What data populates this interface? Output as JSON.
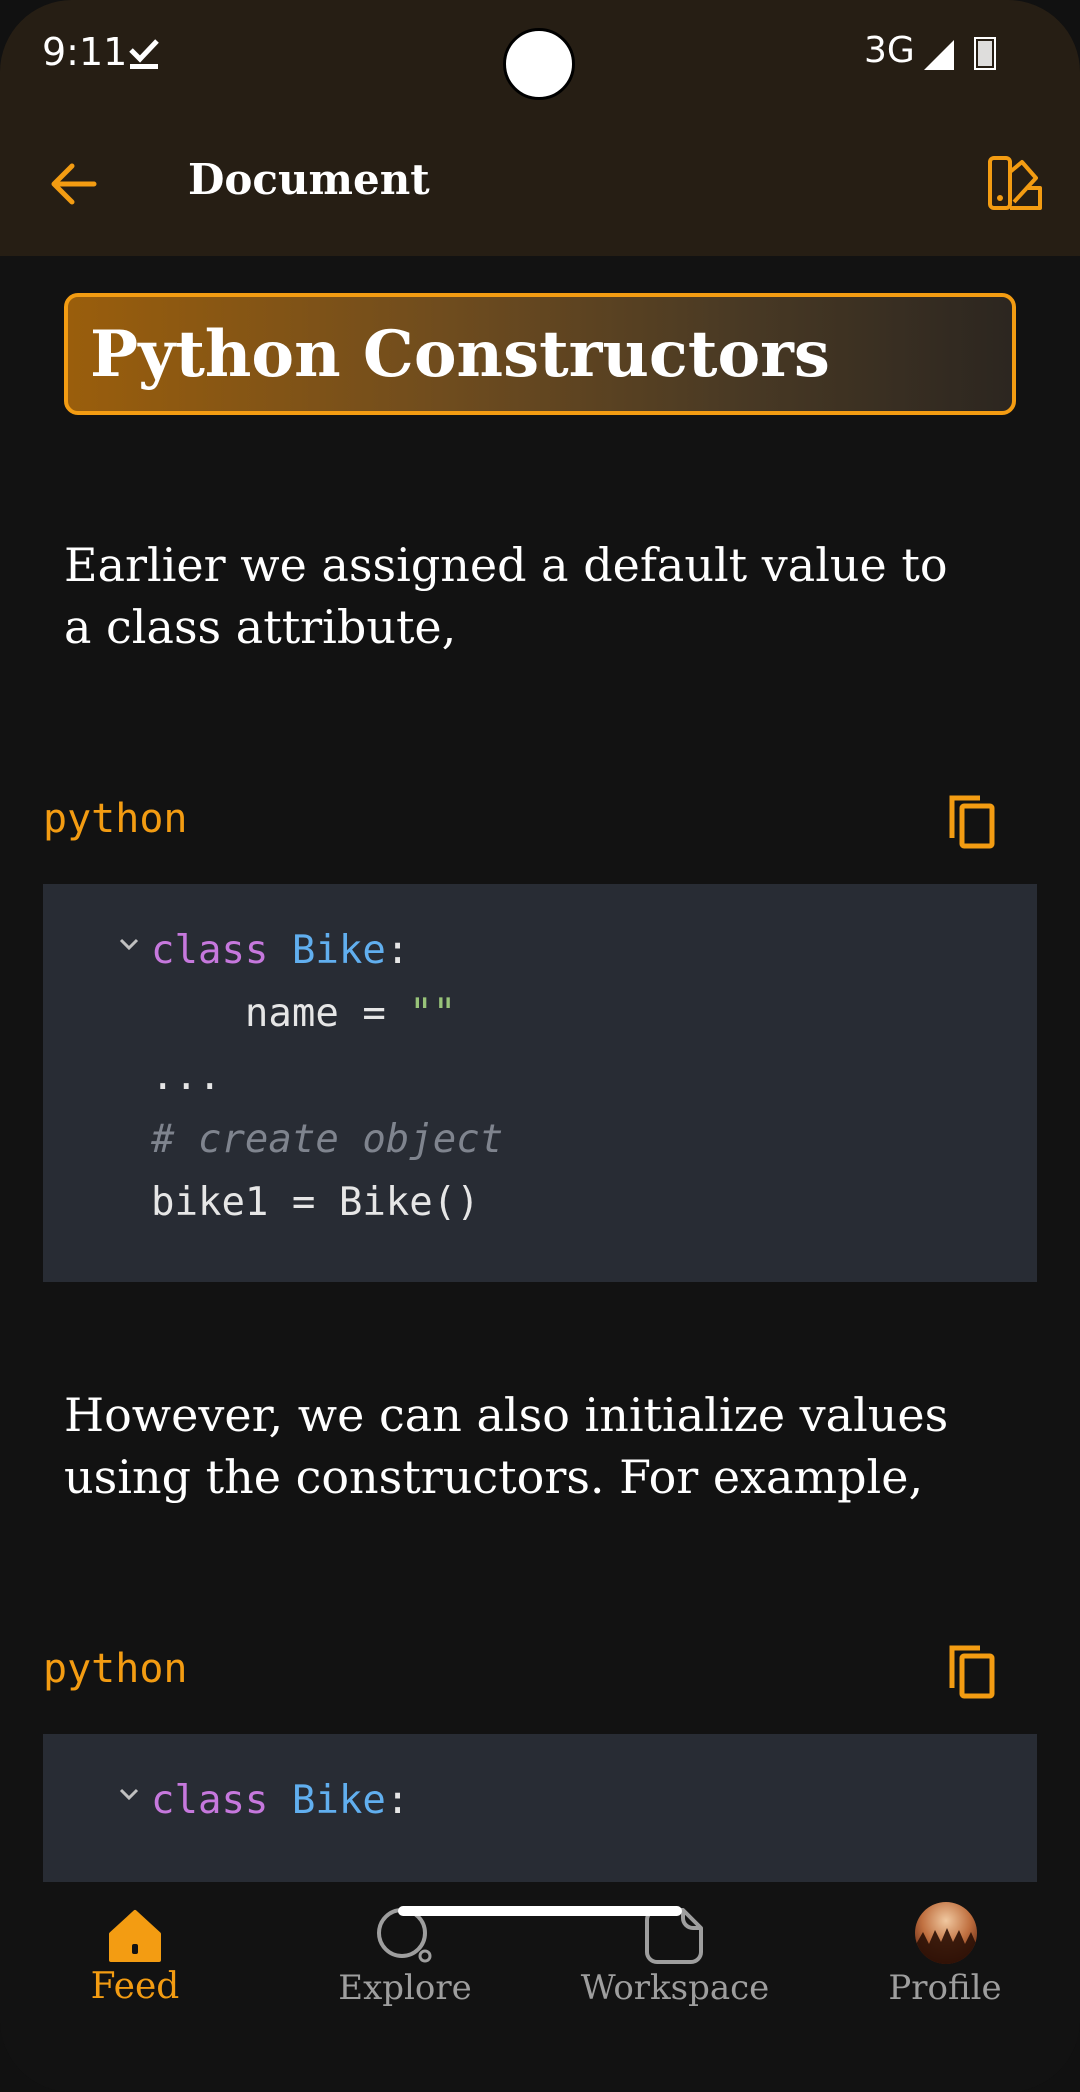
{
  "status_bar": {
    "time": "9:11",
    "network": "3G"
  },
  "app_bar": {
    "title": "Document",
    "back_icon": "arrow-left-icon",
    "theme_icon": "palette-icon"
  },
  "document": {
    "title": "Python Constructors",
    "paragraphs": [
      "Earlier we assigned a default value to a class attribute,",
      "However, we can also initialize values using the constructors. For example,"
    ],
    "code_blocks": [
      {
        "language": "python",
        "lines": {
          "l1_kw": "class",
          "l1_cls": "Bike",
          "l1_rest": ":",
          "l2_a": "    name = ",
          "l2_str": "\"\"",
          "l3": "...",
          "l4": "# create object",
          "l5": "bike1 = Bike()"
        }
      },
      {
        "language": "python",
        "lines": {
          "l1_kw": "class",
          "l1_cls": "Bike",
          "l1_rest": ":"
        }
      }
    ]
  },
  "bottom_nav": {
    "items": [
      {
        "label": "Feed",
        "icon": "home-icon",
        "active": true
      },
      {
        "label": "Explore",
        "icon": "search-icon",
        "active": false
      },
      {
        "label": "Workspace",
        "icon": "note-icon",
        "active": false
      },
      {
        "label": "Profile",
        "icon": "avatar",
        "active": false
      }
    ]
  },
  "colors": {
    "accent": "#f39c12",
    "app_bar_bg": "#261e14",
    "background": "#121212",
    "code_bg": "#282c34",
    "keyword": "#c678dd",
    "class_name": "#61afef",
    "string": "#98c379",
    "comment": "#7f848e"
  }
}
